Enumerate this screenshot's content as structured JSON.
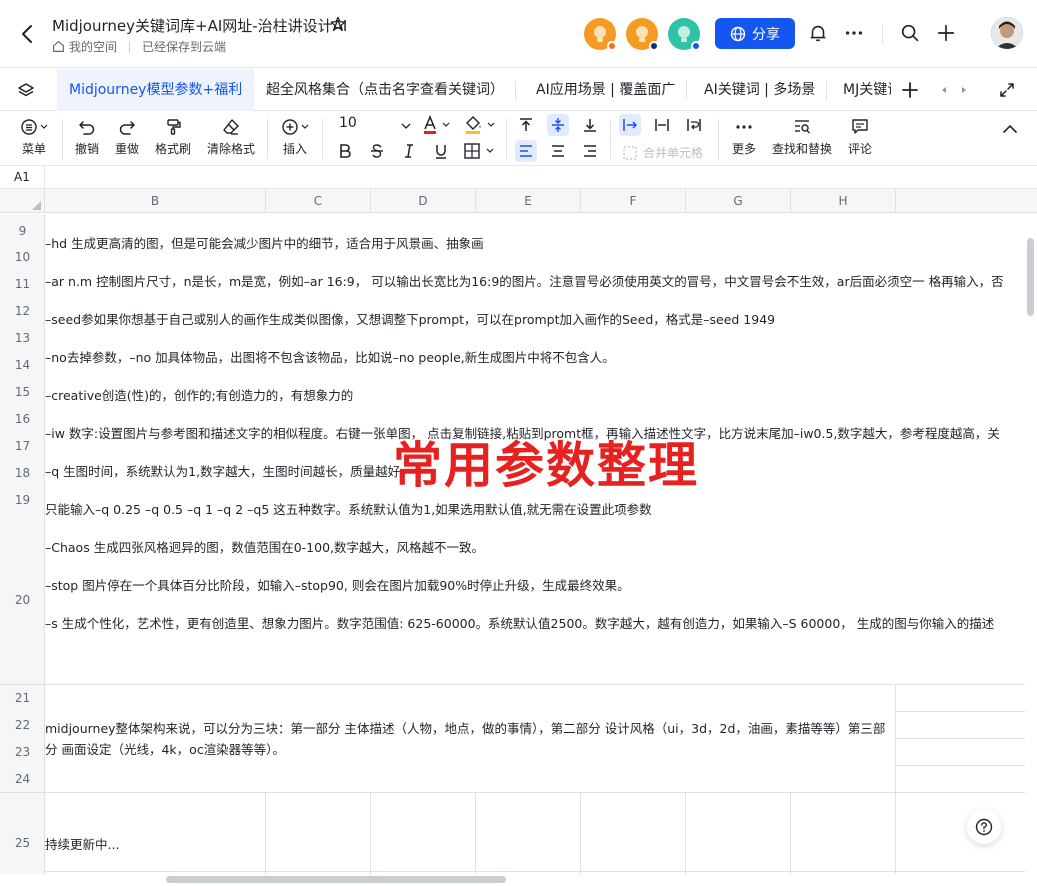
{
  "header": {
    "title": "Midjourney关键词库+AI网址-治柱讲设计AI",
    "space": "我的空间",
    "save_status": "已经保存到云端",
    "share_label": "分享",
    "collaborators": [
      {
        "name": "collaborator-1",
        "color": "#f59a23",
        "dot": "#f76d1c"
      },
      {
        "name": "collaborator-2",
        "color": "#f59a23",
        "dot": "#1f2a66"
      },
      {
        "name": "collaborator-3",
        "color": "#2fc2a7",
        "dot": "#1456f0"
      }
    ]
  },
  "tabs": [
    {
      "label": "Midjourney模型参数+福利",
      "active": true
    },
    {
      "label": "超全风格集合（点击名字查看关键词）",
      "active": false
    },
    {
      "label": "AI应用场景 | 覆盖面广",
      "active": false
    },
    {
      "label": "AI关键词 | 多场景",
      "active": false
    },
    {
      "label": "MJ关键词",
      "active": false
    }
  ],
  "toolbar": {
    "menu": "菜单",
    "undo": "撤销",
    "redo": "重做",
    "format_painter": "格式刷",
    "clear_format": "清除格式",
    "insert": "插入",
    "font_size": "10",
    "merge": "合并单元格",
    "more": "更多",
    "find_replace": "查找和替换",
    "comment": "评论"
  },
  "formula": {
    "cell_ref": "A1"
  },
  "columns": [
    "B",
    "C",
    "D",
    "E",
    "F",
    "G",
    "H"
  ],
  "rows": [
    "9",
    "10",
    "11",
    "12",
    "13",
    "14",
    "15",
    "16",
    "17",
    "18",
    "19",
    "20",
    "21",
    "22",
    "23",
    "24",
    "25"
  ],
  "cells": {
    "params": [
      "–hd 生成更高清的图，但是可能会减少图片中的细节，适合用于风景画、抽象画",
      "–ar n.m 控制图片尺寸，n是长，m是宽，例如–ar 16:9， 可以输出长宽比为16:9的图片。注意冒号必须使用英文的冒号，中文冒号会不生效，ar后面必须空一 格再输入，否",
      "–seed参如果你想基于自己或别人的画作生成类似图像，又想调整下prompt，可以在prompt加入画作的Seed，格式是–seed 1949",
      "–no去掉参数，–no 加具体物品，出图将不包含该物品，比如说–no people,新生成图片中将不包含人。",
      "–creative创造(性)的，创作的;有创造力的，有想象力的",
      "–iw 数字:设置图片与参考图和描述文字的相似程度。右键一张单图， 点击复制链接,粘贴到promt框，再输入描述性文字，比方说末尾加–iw0.5,数字越大，参考程度越高，关",
      "–q 生图时间，系统默认为1,数字越大，生图时间越长，质量越好。",
      "只能输入–q 0.25 –q 0.5 –q 1 –q 2 –q5 这五种数字。系统默认值为1,如果选用默认值,就无需在设置此项参数",
      "–Chaos 生成四张风格迥异的图，数值范围在0-100,数字越大，风格越不一致。",
      "–stop 图片停在一个具体百分比阶段，如输入–stop90, 则会在图片加载90%时停止升级，生成最终效果。",
      "–s 生成个性化，艺术性，更有创造里、想象力图片。数字范围值: 625-60000。系统默认值2500。数字越大，越有创造力，如果输入–S 60000， 生成的图与你输入的描述"
    ],
    "overlay_title": "常用参数整理",
    "structure": "midjourney整体架构来说，可以分为三块：第一部分 主体描述（人物，地点，做的事情），第二部分 设计风格（ui，3d，2d，油画，素描等等）第三部分 画面设定（光线，4k，oc渲染器等等）。",
    "updating": "持续更新中..."
  }
}
